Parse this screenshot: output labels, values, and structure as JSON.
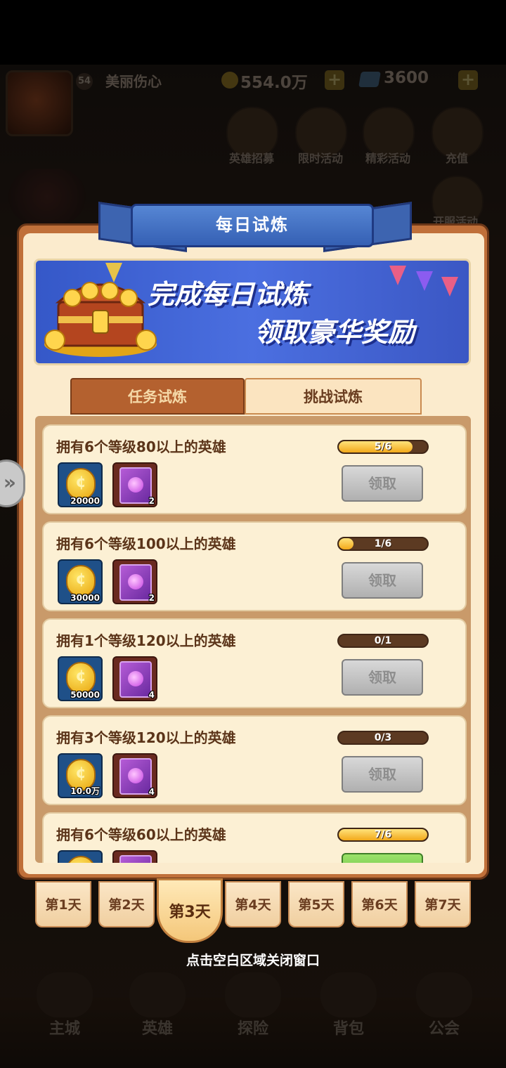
{
  "hud": {
    "level": "54",
    "player_name": "美丽伤心",
    "gold": "554.0万",
    "gems": "3600",
    "avatar_badge": "0",
    "top_buttons": [
      {
        "label": "英雄招募",
        "icon": "hero-recruit-icon"
      },
      {
        "label": "限时活动",
        "icon": "limited-event-icon"
      },
      {
        "label": "精彩活动",
        "icon": "featured-event-icon"
      },
      {
        "label": "充值",
        "icon": "recharge-icon"
      },
      {
        "label": "开服活动",
        "icon": "server-launch-event-icon"
      }
    ]
  },
  "dialog": {
    "title": "每日试炼",
    "banner": {
      "line1": "完成每日试炼",
      "line2": "领取豪华奖励"
    },
    "tabs": [
      {
        "label": "任务试炼",
        "active": false
      },
      {
        "label": "挑战试炼",
        "active": true
      }
    ],
    "tasks": [
      {
        "title": "拥有6个等级80以上的英雄",
        "progress": "5/6",
        "fraction": 0.83,
        "coin_qty": "20000",
        "orb_qty": "2",
        "claim_label": "领取",
        "claimable": false
      },
      {
        "title": "拥有6个等级100以上的英雄",
        "progress": "1/6",
        "fraction": 0.17,
        "coin_qty": "30000",
        "orb_qty": "2",
        "claim_label": "领取",
        "claimable": false
      },
      {
        "title": "拥有1个等级120以上的英雄",
        "progress": "0/1",
        "fraction": 0.0,
        "coin_qty": "50000",
        "orb_qty": "4",
        "claim_label": "领取",
        "claimable": false
      },
      {
        "title": "拥有3个等级120以上的英雄",
        "progress": "0/3",
        "fraction": 0.0,
        "coin_qty": "10.0万",
        "orb_qty": "4",
        "claim_label": "领取",
        "claimable": false
      },
      {
        "title": "拥有6个等级60以上的英雄",
        "progress": "7/6",
        "fraction": 1.0,
        "coin_qty": "",
        "orb_qty": "",
        "claim_label": "",
        "claimable": true
      }
    ],
    "days": [
      "第1天",
      "第2天",
      "第3天",
      "第4天",
      "第5天",
      "第6天",
      "第7天"
    ],
    "active_day": 2,
    "close_hint": "点击空白区域关闭窗口"
  },
  "bottom_nav": [
    {
      "label": "主城",
      "icon": "main-city-icon"
    },
    {
      "label": "英雄",
      "icon": "hero-icon"
    },
    {
      "label": "探险",
      "icon": "explore-icon"
    },
    {
      "label": "背包",
      "icon": "backpack-icon"
    },
    {
      "label": "公会",
      "icon": "guild-icon"
    }
  ],
  "colors": {
    "dialog_frame": "#c0703a",
    "dialog_bg": "#fbebcd",
    "ribbon": "#3560b4",
    "progress_fill": "#f2a81a"
  }
}
